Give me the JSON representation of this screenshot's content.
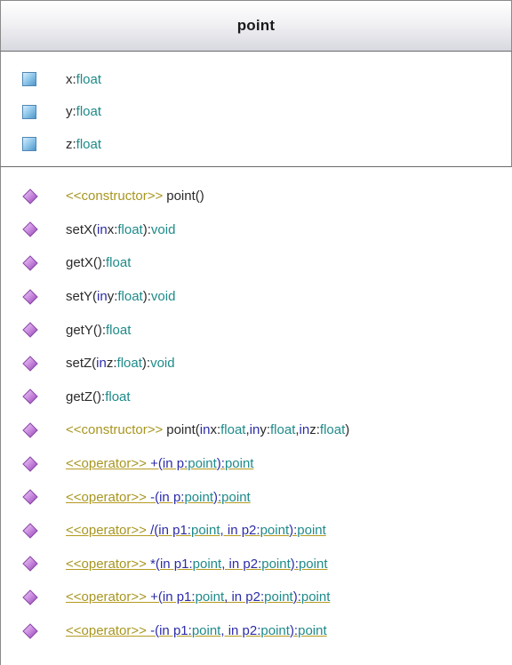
{
  "class": {
    "name": "point"
  },
  "attributes": [
    {
      "name": "x",
      "sep": ":",
      "type": "float"
    },
    {
      "name": "y",
      "sep": ":",
      "type": "float"
    },
    {
      "name": "z",
      "sep": ":",
      "type": "float"
    }
  ],
  "operations": [
    {
      "stereo": "<<constructor>>",
      "name": "point()",
      "p1": "",
      "p2": "",
      "p3": "",
      "p4": "",
      "p5": "",
      "p6": "",
      "p7": "",
      "p8": "",
      "p9": "",
      "p10": "",
      "p11": "",
      "p12": ""
    },
    {
      "stereo": "",
      "name": "setX(",
      "kw1": "in",
      "p1": " x:",
      "t1": "float",
      "end": "):",
      "ret": "void"
    },
    {
      "stereo": "",
      "name": "getX():",
      "ret": "float"
    },
    {
      "stereo": "",
      "name": "setY(",
      "kw1": "in",
      "p1": " y:",
      "t1": "float",
      "end": "):",
      "ret": "void"
    },
    {
      "stereo": "",
      "name": "getY():",
      "ret": "float"
    },
    {
      "stereo": "",
      "name": "setZ(",
      "kw1": "in",
      "p1": " z:",
      "t1": "float",
      "end": "):",
      "ret": "void"
    },
    {
      "stereo": "",
      "name": "getZ():",
      "ret": "float"
    },
    {
      "stereo": "<<constructor>>",
      "name": "point(",
      "kw1": "in",
      "p1": " x:",
      "t1": "float",
      "c1": ", ",
      "kw2": "in",
      "p2": " y:",
      "t2": "float",
      "c2": ", ",
      "kw3": "in",
      "p3": " z:",
      "t3": "float",
      "end": ")"
    },
    {
      "stereo": "<<operator>>",
      "name": "+(",
      "kw1": "in",
      "p1": " p:",
      "t1": "point",
      "end": "):",
      "ret": "point"
    },
    {
      "stereo": "<<operator>>",
      "name": "-(",
      "kw1": "in",
      "p1": " p:",
      "t1": "point",
      "end": "):",
      "ret": "point"
    },
    {
      "stereo": "<<operator>>",
      "name": "/(",
      "kw1": "in",
      "p1": " p1:",
      "t1": "point",
      "c1": ", ",
      "kw2": "in",
      "p2": " p2:",
      "t2": "point",
      "end": "):",
      "ret": "point"
    },
    {
      "stereo": "<<operator>>",
      "name": "*(",
      "kw1": "in",
      "p1": " p1:",
      "t1": "point",
      "c1": ", ",
      "kw2": "in",
      "p2": " p2:",
      "t2": "point",
      "end": "):",
      "ret": "point"
    },
    {
      "stereo": "<<operator>>",
      "name": "+(",
      "kw1": "in",
      "p1": " p1:",
      "t1": "point",
      "c1": ", ",
      "kw2": "in",
      "p2": " p2:",
      "t2": "point",
      "end": "):",
      "ret": "point"
    },
    {
      "stereo": "<<operator>>",
      "name": "-(",
      "kw1": "in",
      "p1": " p1:",
      "t1": "point",
      "c1": ", ",
      "kw2": "in",
      "p2": " p2:",
      "t2": "point",
      "end": "):",
      "ret": "point"
    }
  ],
  "colors": {
    "header_gradient_end": "#d8d9e0",
    "type_text": "#1f8a8a",
    "keyword_text": "#2c2ca8",
    "stereotype_text": "#a89620",
    "attribute_icon": "#8ec6ea",
    "operation_icon": "#c27ad6"
  },
  "icons": {
    "attribute": "attribute-field-icon",
    "operation": "operation-diamond-icon"
  }
}
